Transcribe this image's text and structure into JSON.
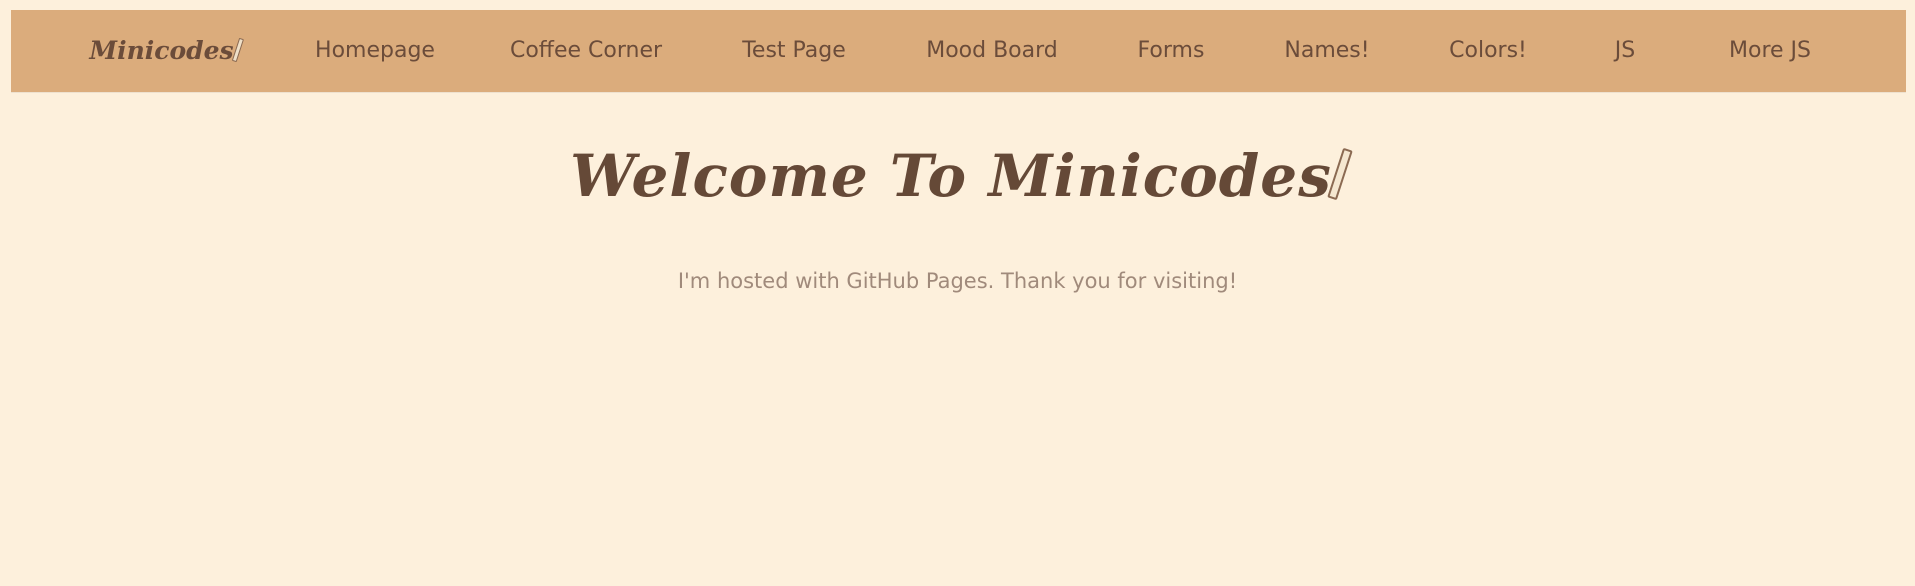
{
  "nav": {
    "brand": "Minicodes",
    "brand_icon": "pencil-icon",
    "items": [
      {
        "label": "Homepage"
      },
      {
        "label": "Coffee Corner"
      },
      {
        "label": "Test Page"
      },
      {
        "label": "Mood Board"
      },
      {
        "label": "Forms"
      },
      {
        "label": "Names!"
      },
      {
        "label": "Colors!"
      },
      {
        "label": "JS"
      },
      {
        "label": "More JS"
      }
    ]
  },
  "hero": {
    "title": "Welcome To Minicodes",
    "title_icon": "pencil-icon",
    "subtitle": "I'm hosted with GitHub Pages. Thank you for visiting!"
  },
  "colors": {
    "page_background": "#fdf0dc",
    "navbar_background": "#dbac7c",
    "heading_text": "#654937",
    "subtitle_text": "#a08a7b"
  }
}
